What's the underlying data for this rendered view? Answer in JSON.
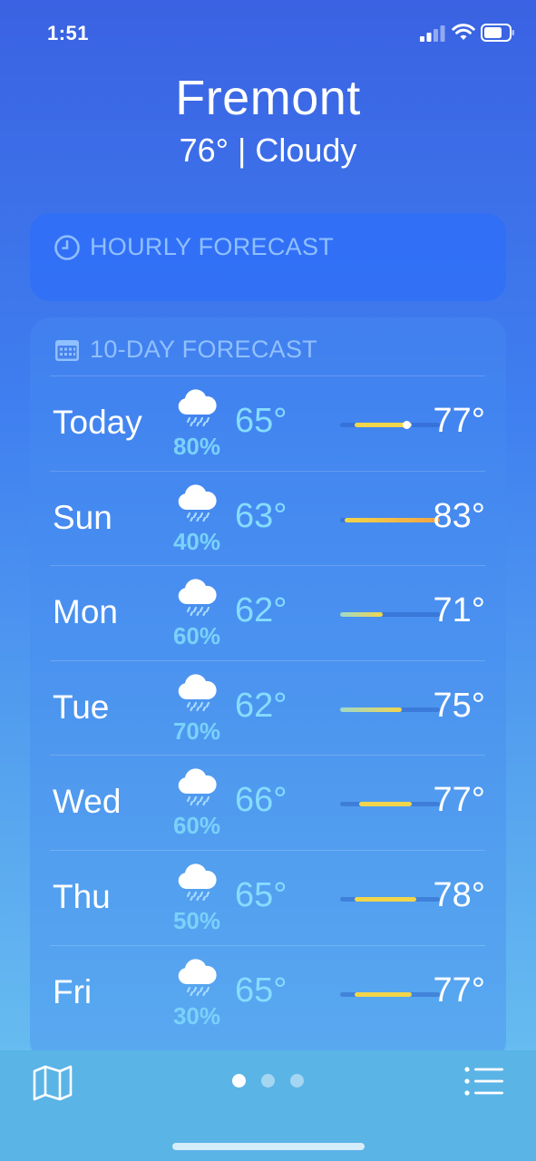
{
  "status_bar": {
    "time": "1:51"
  },
  "header": {
    "city": "Fremont",
    "temp": "76°",
    "separator": "|",
    "condition": "Cloudy"
  },
  "hourly": {
    "title": "HOURLY FORECAST"
  },
  "daily": {
    "title": "10-DAY FORECAST",
    "scale_min": 62,
    "scale_max": 83,
    "days": [
      {
        "day": "Today",
        "pop": "80%",
        "low": "65°",
        "high": "77°",
        "low_val": 65,
        "high_val": 77,
        "current": 76
      },
      {
        "day": "Sun",
        "pop": "40%",
        "low": "63°",
        "high": "83°",
        "low_val": 63,
        "high_val": 83
      },
      {
        "day": "Mon",
        "pop": "60%",
        "low": "62°",
        "high": "71°",
        "low_val": 62,
        "high_val": 71
      },
      {
        "day": "Tue",
        "pop": "70%",
        "low": "62°",
        "high": "75°",
        "low_val": 62,
        "high_val": 75
      },
      {
        "day": "Wed",
        "pop": "60%",
        "low": "66°",
        "high": "77°",
        "low_val": 66,
        "high_val": 77
      },
      {
        "day": "Thu",
        "pop": "50%",
        "low": "65°",
        "high": "78°",
        "low_val": 65,
        "high_val": 78
      },
      {
        "day": "Fri",
        "pop": "30%",
        "low": "65°",
        "high": "77°",
        "low_val": 65,
        "high_val": 77
      }
    ]
  },
  "icons": {
    "status": [
      "signal-icon",
      "wifi-icon",
      "battery-icon"
    ],
    "hourly": "clock-icon",
    "daily": "calendar-icon",
    "condition": "cloud-rain-icon",
    "toolbar_left": "map-icon",
    "toolbar_right": "list-icon"
  },
  "colors": {
    "bar_cool": "#9fd9c9",
    "bar_warm": "#f2d54a",
    "bar_hot": "#f3a343",
    "low_temp": "#86dcff",
    "pop": "#79d2fa"
  },
  "pages": {
    "count": 3,
    "active": 0
  }
}
